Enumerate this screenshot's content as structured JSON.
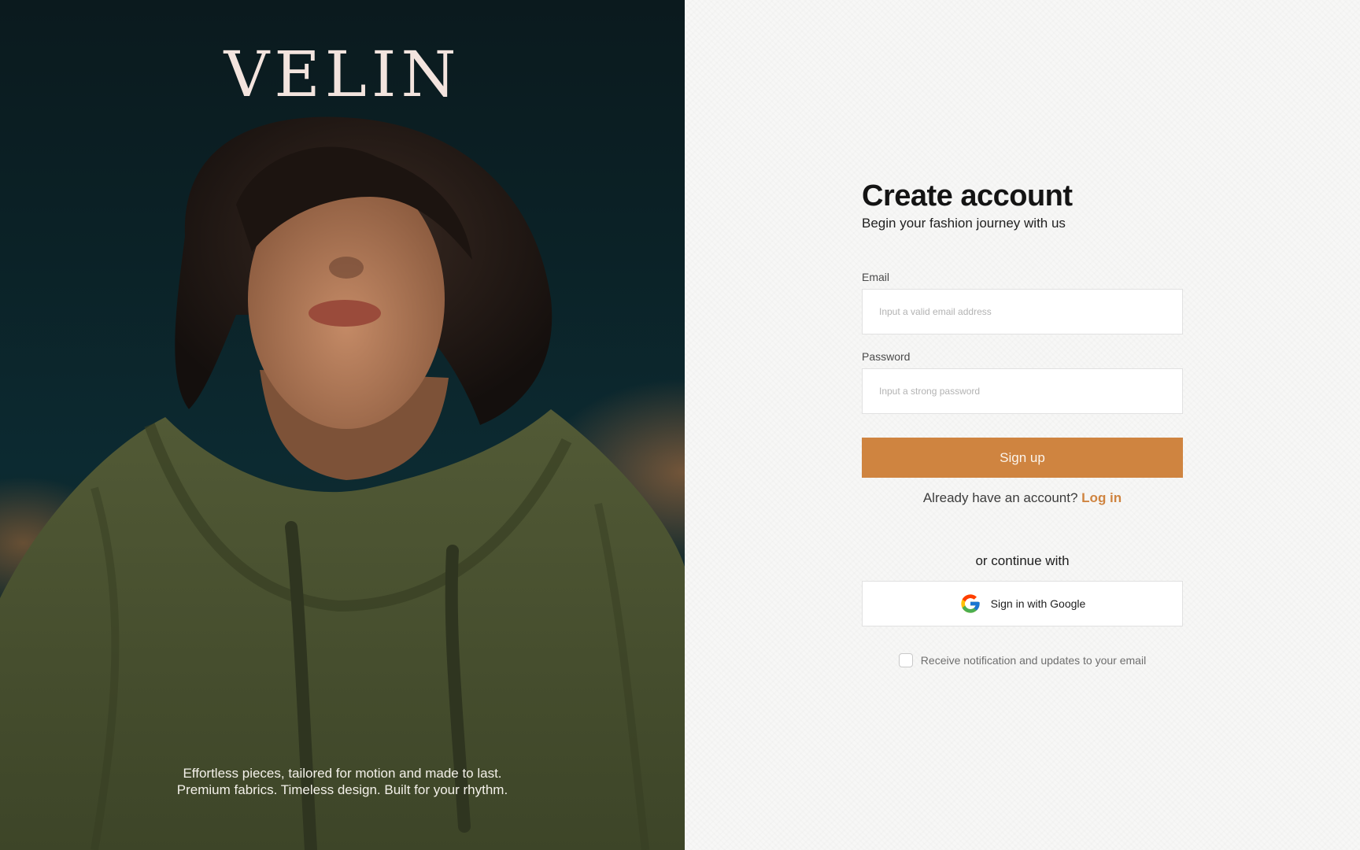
{
  "hero": {
    "brand": "VELIN",
    "caption_line1": "Effortless pieces, tailored for motion and made to last.",
    "caption_line2": "Premium fabrics. Timeless design. Built for your rhythm."
  },
  "form": {
    "title": "Create account",
    "subtitle": "Begin your fashion journey with us",
    "email_label": "Email",
    "email_placeholder": "Input a valid email address",
    "email_value": "",
    "password_label": "Password",
    "password_placeholder": "Input a strong password",
    "password_value": "",
    "signup_label": "Sign up",
    "login_prompt": "Already have an account?",
    "login_link": "Log in",
    "divider": "or continue with",
    "google_label": "Sign in with Google",
    "consent_label": "Receive notification and updates to your email",
    "consent_checked": false
  },
  "colors": {
    "accent": "#cf8440",
    "panel_bg": "#f7f7f6",
    "hero_bg": "#0c2a31",
    "hoodie": "#4a5230"
  },
  "icons": {
    "google": "google-icon"
  }
}
